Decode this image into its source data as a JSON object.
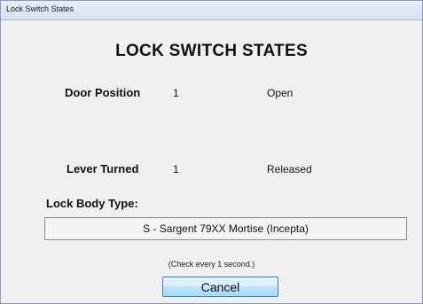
{
  "window": {
    "title": "Lock Switch States"
  },
  "heading": "LOCK SWITCH STATES",
  "switches": [
    {
      "label": "Door Position",
      "value": "1",
      "state": "Open"
    },
    {
      "label": "Lever Turned",
      "value": "1",
      "state": "Released"
    }
  ],
  "lock_body": {
    "label": "Lock Body Type:",
    "value": "S - Sargent 79XX Mortise (Incepta)"
  },
  "note": "(Check every 1 second.)",
  "cancel_label": "Cancel"
}
